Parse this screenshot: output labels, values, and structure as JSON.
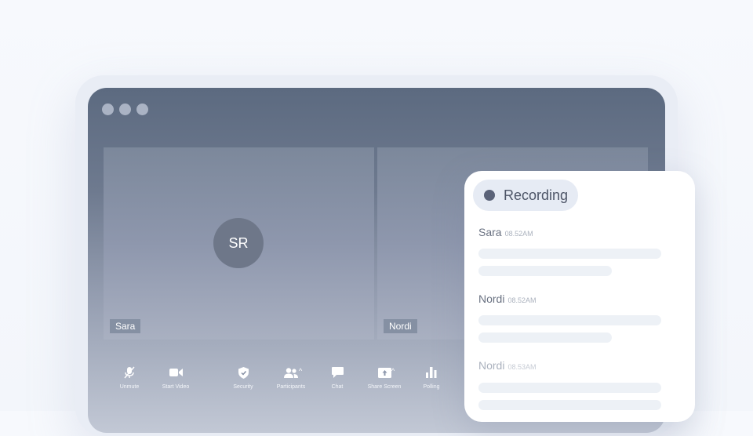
{
  "video": {
    "participants": [
      {
        "initials": "SR",
        "name": "Sara"
      },
      {
        "initials": "",
        "name": "Nordi"
      }
    ]
  },
  "toolbar": {
    "unmute": "Unmute",
    "start_video": "Start Video",
    "security": "Security",
    "participants": "Participants",
    "chat": "Chat",
    "share_screen": "Share Screen",
    "polling": "Polling"
  },
  "panel": {
    "recording_label": "Recording",
    "messages": [
      {
        "sender": "Sara",
        "time": "08.52AM"
      },
      {
        "sender": "Nordi",
        "time": "08.52AM"
      },
      {
        "sender": "Nordi",
        "time": "08.53AM"
      }
    ]
  },
  "colors": {
    "window_top": "#5c6a80",
    "tile": "#8e97ad",
    "avatar": "#6e7789",
    "recording_dot": "#5b6379",
    "pill_bg": "#e6ebf4"
  }
}
